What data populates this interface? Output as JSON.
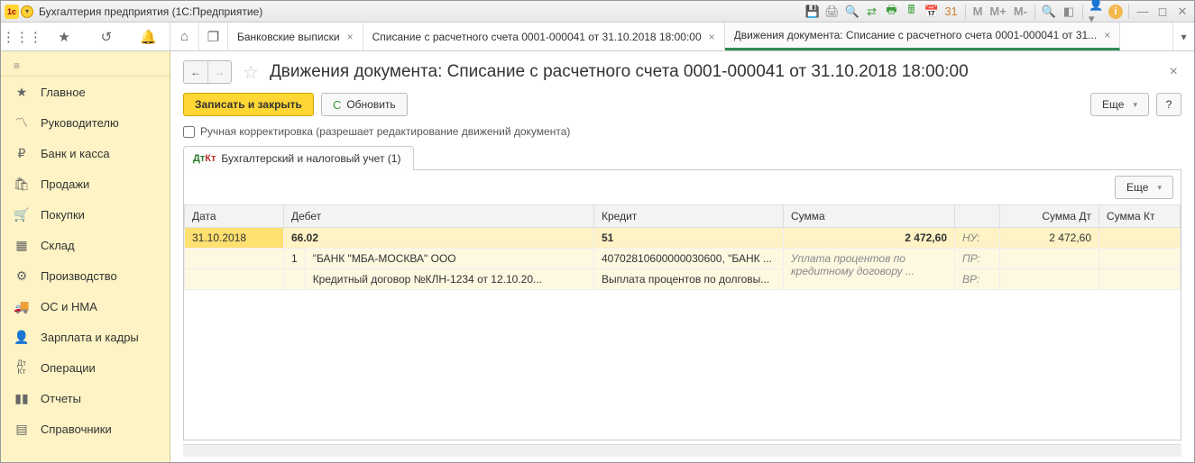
{
  "titlebar": {
    "app_title": "Бухгалтерия предприятия  (1С:Предприятие)",
    "m_buttons": [
      "M",
      "M+",
      "M-"
    ]
  },
  "tabs": [
    {
      "label": "Банковские выписки"
    },
    {
      "label": "Списание с расчетного счета 0001-000041 от 31.10.2018 18:00:00"
    },
    {
      "label": "Движения документа: Списание с расчетного счета 0001-000041 от 31...",
      "active": true
    }
  ],
  "sidebar": {
    "items": [
      {
        "icon": "≡",
        "label": "Главное"
      },
      {
        "icon": "📈",
        "label": "Руководителю"
      },
      {
        "icon": "₽",
        "label": "Банк и касса"
      },
      {
        "icon": "🛍",
        "label": "Продажи"
      },
      {
        "icon": "🛒",
        "label": "Покупки"
      },
      {
        "icon": "▦",
        "label": "Склад"
      },
      {
        "icon": "🏭",
        "label": "Производство"
      },
      {
        "icon": "🚚",
        "label": "ОС и НМА"
      },
      {
        "icon": "👤",
        "label": "Зарплата и кадры"
      },
      {
        "icon": "ДтКт",
        "label": "Операции"
      },
      {
        "icon": "📊",
        "label": "Отчеты"
      },
      {
        "icon": "📚",
        "label": "Справочники"
      }
    ]
  },
  "page": {
    "title": "Движения документа: Списание с расчетного счета 0001-000041 от 31.10.2018 18:00:00",
    "save_close": "Записать и закрыть",
    "refresh": "Обновить",
    "more": "Еще",
    "help": "?",
    "checkbox_label": "Ручная корректировка (разрешает редактирование движений документа)",
    "subtab": "Бухгалтерский и налоговый учет (1)",
    "grid_more": "Еще"
  },
  "grid": {
    "headers": {
      "date": "Дата",
      "debit": "Дебет",
      "credit": "Кредит",
      "sum": "Сумма",
      "sum_dt": "Сумма Дт",
      "sum_kt": "Сумма Кт"
    },
    "row1": {
      "date": "31.10.2018",
      "debit": "66.02",
      "credit": "51",
      "sum": "2 472,60",
      "nu": "НУ:",
      "sum_dt": "2 472,60"
    },
    "row2": {
      "n": "1",
      "debit": "\"БАНК \"МБА-МОСКВА\" ООО",
      "credit": "40702810600000030600, \"БАНК ...",
      "sum": "Уплата процентов по кредитному договору ...",
      "pr": "ПР:"
    },
    "row3": {
      "debit": "Кредитный договор №КЛН-1234 от 12.10.20...",
      "credit": "Выплата процентов по долговы...",
      "vr": "ВР:"
    }
  }
}
